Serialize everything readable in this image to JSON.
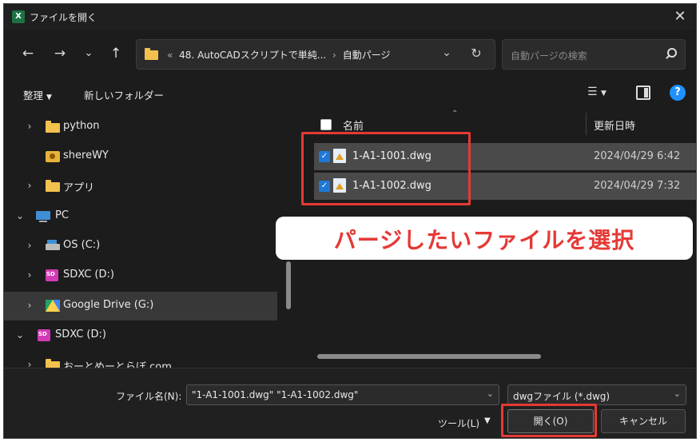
{
  "window": {
    "title": "ファイルを開く",
    "app_icon": "excel-icon"
  },
  "nav": {
    "address_path": [
      "48. AutoCADスクリプトで単純...",
      "自動パージ"
    ],
    "address_prefix": "«",
    "search_placeholder": "自動パージの検索"
  },
  "toolbar": {
    "organize_label": "整理",
    "new_folder_label": "新しいフォルダー",
    "help_label": "?"
  },
  "sidebar": {
    "items": [
      {
        "label": "python",
        "icon": "folder-icon",
        "expandable": true
      },
      {
        "label": "shereWY",
        "icon": "shared-folder-icon",
        "expandable": false
      },
      {
        "label": "アプリ",
        "icon": "folder-icon",
        "expandable": true
      },
      {
        "label": "PC",
        "icon": "pc-icon",
        "expanded": true
      },
      {
        "label": "OS (C:)",
        "icon": "drive-icon",
        "expandable": true
      },
      {
        "label": "SDXC (D:)",
        "icon": "sd-card-icon",
        "expandable": true
      },
      {
        "label": "Google Drive (G:)",
        "icon": "google-drive-icon",
        "expandable": true,
        "selected": true
      },
      {
        "label": "SDXC (D:)",
        "icon": "sd-card-icon",
        "expanded": true
      },
      {
        "label": "おーとめーとらぼ.com",
        "icon": "folder-icon",
        "expandable": true
      }
    ]
  },
  "filelist": {
    "col_name": "名前",
    "col_date": "更新日時",
    "files": [
      {
        "name": "1-A1-1001.dwg",
        "date": "2024/04/29 6:42",
        "checked": true
      },
      {
        "name": "1-A1-1002.dwg",
        "date": "2024/04/29 7:32",
        "checked": true
      }
    ]
  },
  "callout": {
    "text": "パージしたいファイルを選択",
    "color": "#e53935"
  },
  "bottom": {
    "filename_label": "ファイル名(N):",
    "filename_value": "\"1-A1-1001.dwg\" \"1-A1-1002.dwg\"",
    "filetype_value": "dwgファイル (*.dwg)",
    "tools_label": "ツール(L)",
    "open_label": "開く(O)",
    "cancel_label": "キャンセル"
  }
}
